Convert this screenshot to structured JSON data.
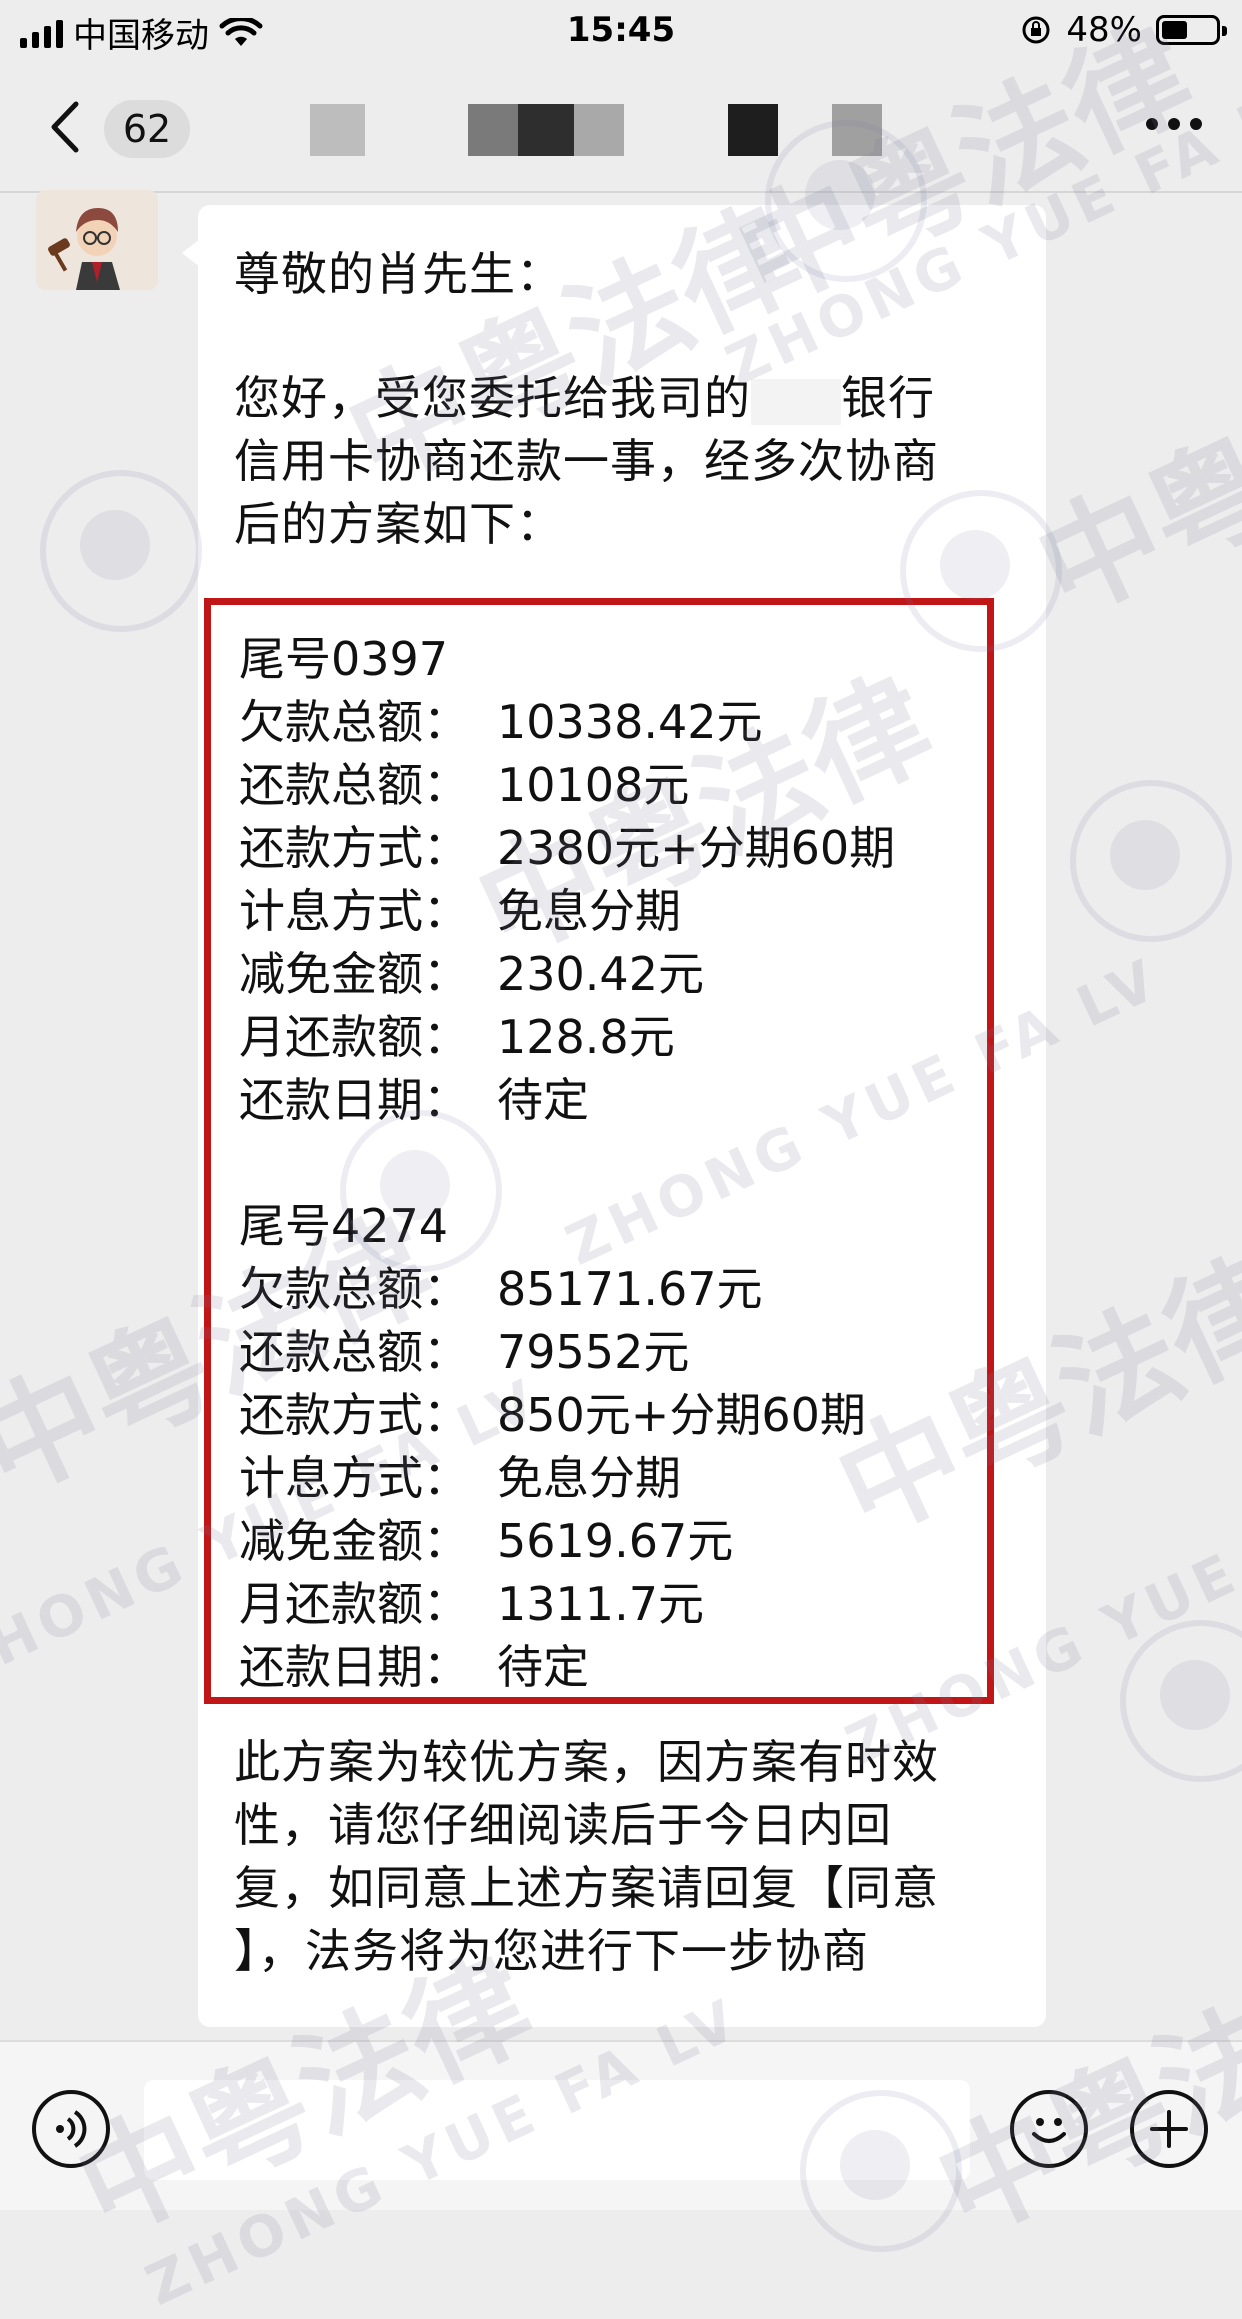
{
  "status_bar": {
    "carrier": "中国移动",
    "time": "15:45",
    "battery_percent_text": "48%",
    "battery_level": 0.48
  },
  "nav": {
    "unread_count": "62"
  },
  "message": {
    "greeting": "尊敬的肖先生：",
    "intro_line1a": "您好，受您委托给我司的",
    "intro_line1b": "银行",
    "intro_line2": "信用卡协商还款一事，经多次协商",
    "intro_line3": "后的方案如下：",
    "plans": [
      {
        "title": "尾号0397",
        "rows": [
          {
            "label": "欠款总额：",
            "value": "10338.42元"
          },
          {
            "label": "还款总额：",
            "value": "10108元"
          },
          {
            "label": "还款方式：",
            "value": "2380元+分期60期"
          },
          {
            "label": "计息方式：",
            "value": "免息分期"
          },
          {
            "label": "减免金额：",
            "value": "230.42元"
          },
          {
            "label": "月还款额：",
            "value": "128.8元"
          },
          {
            "label": "还款日期：",
            "value": "待定"
          }
        ]
      },
      {
        "title": "尾号4274",
        "rows": [
          {
            "label": "欠款总额：",
            "value": "85171.67元"
          },
          {
            "label": "还款总额：",
            "value": "79552元"
          },
          {
            "label": "还款方式：",
            "value": "850元+分期60期"
          },
          {
            "label": "计息方式：",
            "value": "免息分期"
          },
          {
            "label": "减免金额：",
            "value": "5619.67元"
          },
          {
            "label": "月还款额：",
            "value": "1311.7元"
          },
          {
            "label": "还款日期：",
            "value": "待定"
          }
        ]
      }
    ],
    "closing_line1": "此方案为较优方案，因方案有时效",
    "closing_line2": "性，请您仔细阅读后于今日内回",
    "closing_line3": "复，如同意上述方案请回复【同意",
    "closing_line4": "】，法务将为您进行下一步协商"
  },
  "watermark": {
    "cn": "中粤法律",
    "en": "ZHONG YUE FA LV"
  },
  "colors": {
    "highlight_border": "#c01618",
    "background": "#ededed",
    "bubble": "#ffffff"
  },
  "icons": [
    "back-chevron-icon",
    "more-dots-icon",
    "voice-icon",
    "emoji-icon",
    "plus-icon"
  ]
}
